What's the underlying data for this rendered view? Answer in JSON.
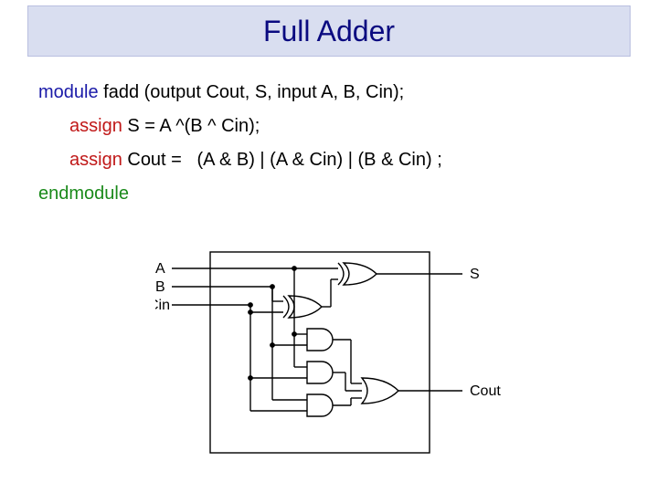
{
  "title": "Full Adder",
  "code": {
    "kw_module": "module",
    "module_decl": " fadd (output Cout, S, input A, B, Cin);",
    "kw_assign1": "assign",
    "assign1": " S = A ^(B ^ Cin);",
    "kw_assign2": "assign",
    "assign2": " Cout =   (A & B) | (A & Cin) | (B & Cin) ;",
    "kw_end": "endmodule"
  },
  "diagram": {
    "inputs": {
      "A": "A",
      "B": "B",
      "Cin": "Cin"
    },
    "outputs": {
      "S": "S",
      "Cout": "Cout"
    },
    "gates": [
      "xor",
      "xor",
      "and",
      "and",
      "and",
      "or"
    ]
  }
}
